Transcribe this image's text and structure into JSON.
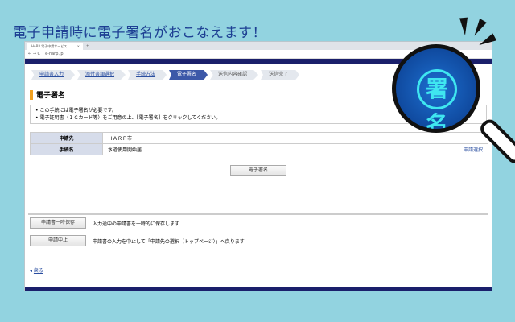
{
  "headline": "電子申請時に電子署名がおこなえます！",
  "browser": {
    "tab_title": "HARP 電子申請サービス",
    "tab_close": "×",
    "new_tab": "+",
    "address": "e-harp.jp",
    "nav": "← → C"
  },
  "steps": [
    {
      "label": "申請書入力",
      "state": "done"
    },
    {
      "label": "添付書類選択",
      "state": "done"
    },
    {
      "label": "手続方法",
      "state": "done"
    },
    {
      "label": "電子署名",
      "state": "current"
    },
    {
      "label": "送信内容確認",
      "state": "future"
    },
    {
      "label": "送信完了",
      "state": "future"
    }
  ],
  "heading": "電子署名",
  "notes": [
    "この手続には電子署名が必要です。",
    "電子証明書（ＩＣカード等）をご用意の上、【電子署名】をクリックしてください。"
  ],
  "info": {
    "rows": [
      {
        "key": "申請先",
        "value": "ＨＡＲＰ市"
      },
      {
        "key": "手続名",
        "value": "水道使用開始届",
        "link": "申請選択"
      }
    ]
  },
  "sign_button": "電子署名",
  "actions": [
    {
      "button": "申請書一時保存",
      "desc": "入力途中の申請書を一時的に保存します"
    },
    {
      "button": "申請中止",
      "desc": "申請書の入力を中止して「申請先の選択（トップページ）」へ戻ります"
    }
  ],
  "back_link": "戻る",
  "magnifier_seal": "署名"
}
